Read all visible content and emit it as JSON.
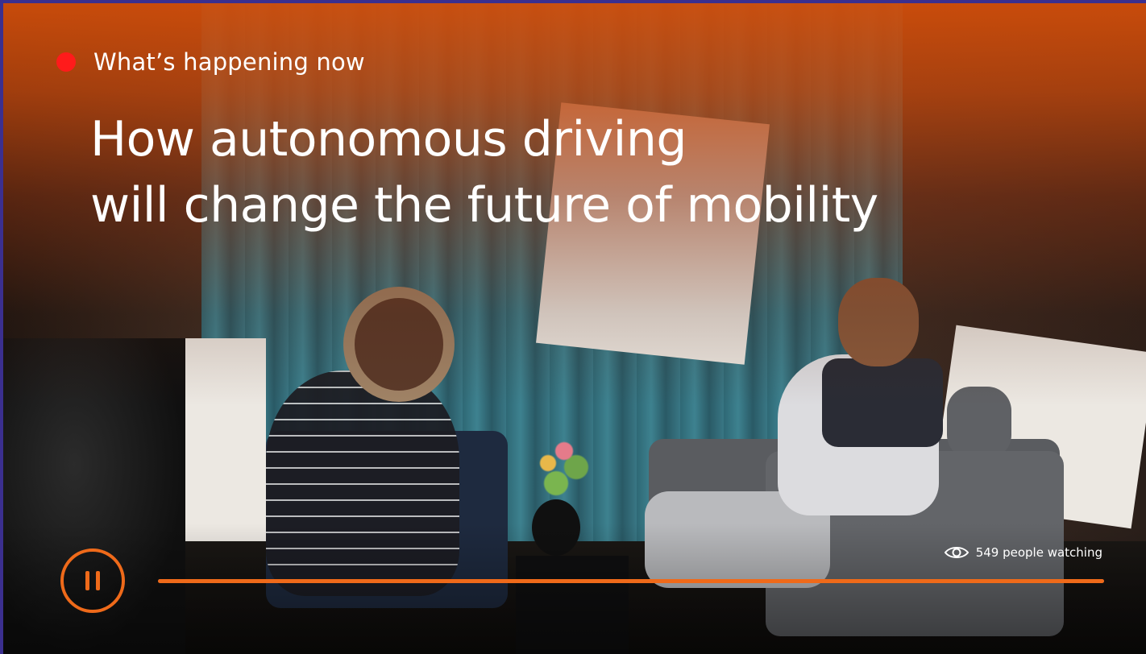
{
  "live": {
    "indicator_color": "#ff1b1b",
    "label": "What’s happening now"
  },
  "headline": {
    "line1": "How autonomous driving",
    "line2": "will change the future of mobility"
  },
  "viewers": {
    "icon": "eye-icon",
    "text": "549 people watching"
  },
  "player": {
    "state": "playing",
    "control_icon": "pause-icon",
    "progress_fraction": 1.0,
    "accent_color": "#ef6a1a"
  }
}
